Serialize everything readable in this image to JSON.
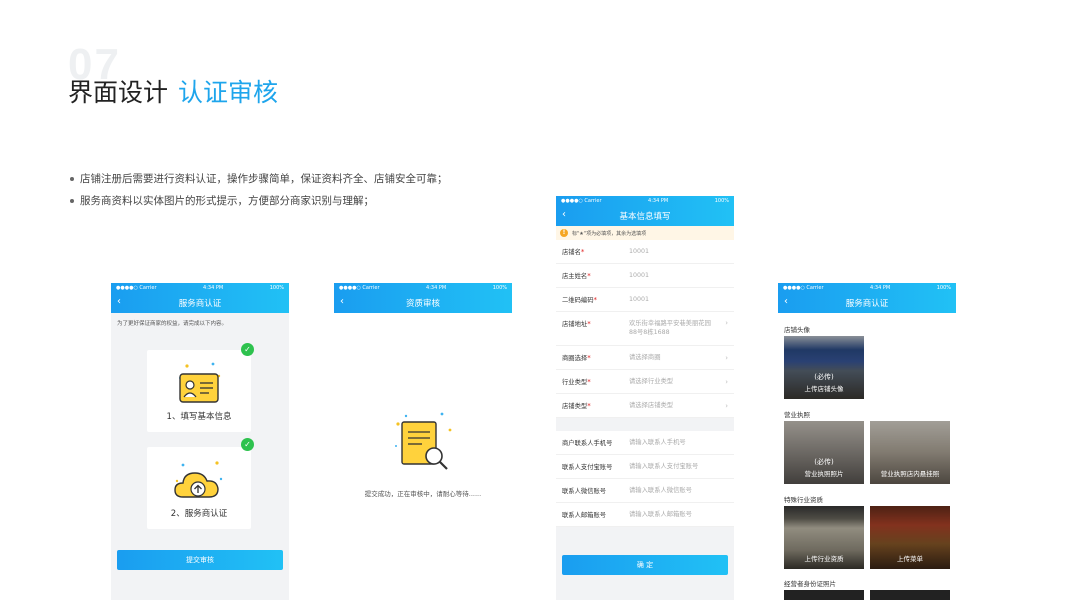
{
  "header": {
    "section_number": "07",
    "title_main": "界面设计",
    "title_accent": "认证审核"
  },
  "bullets": [
    "店铺注册后需要进行资料认证，操作步骤简单，保证资料齐全、店铺安全可靠；",
    "服务商资料以实体图片的形式提示，方便部分商家识别与理解；"
  ],
  "status_bar": {
    "carrier": "●●●●○ Carrier",
    "time": "4:34 PM",
    "battery": "100%"
  },
  "screen1": {
    "nav_title": "服务商认证",
    "hint": "为了更好保证商家的权益，请完成以下内容。",
    "steps": [
      {
        "label": "1、填写基本信息",
        "icon": "id-card-icon"
      },
      {
        "label": "2、服务商认证",
        "icon": "cloud-upload-icon"
      }
    ],
    "submit": "提交审核"
  },
  "screen2": {
    "nav_title": "资质审核",
    "message": "提交成功，正在审核中，请耐心等待......"
  },
  "screen3": {
    "nav_title": "基本信息填写",
    "notice": "标\"★\"项为必填项，其余为选填项",
    "fields": [
      {
        "label": "店铺名",
        "required": true,
        "value": "10001"
      },
      {
        "label": "店主姓名",
        "required": true,
        "value": "10001"
      },
      {
        "label": "二维码编码",
        "required": true,
        "value": "10001"
      },
      {
        "label": "店铺地址",
        "required": true,
        "value": "欢乐街幸福路平安巷美丽花园88号8栋1688",
        "arrow": true
      },
      {
        "label": "商圈选择",
        "required": true,
        "value": "请选择商圈",
        "arrow": true
      },
      {
        "label": "行业类型",
        "required": true,
        "value": "请选择行业类型",
        "arrow": true
      },
      {
        "label": "店铺类型",
        "required": true,
        "value": "请选择店铺类型",
        "arrow": true
      }
    ],
    "contacts": [
      {
        "label": "商户联系人手机号",
        "placeholder": "请输入联系人手机号"
      },
      {
        "label": "联系人支付宝账号",
        "placeholder": "请输入联系人支付宝账号"
      },
      {
        "label": "联系人微信账号",
        "placeholder": "请输入联系人微信账号"
      },
      {
        "label": "联系人邮箱账号",
        "placeholder": "请输入联系人邮箱账号"
      }
    ],
    "confirm": "确 定"
  },
  "screen4": {
    "nav_title": "服务商认证",
    "sections": {
      "shop_avatar": "店铺头像",
      "license": "营业执照",
      "industry": "特殊行业资质",
      "id_photo": "经营者身份证照片"
    },
    "photos": {
      "shop_must": "(必传)",
      "shop_cap": "上传店铺头像",
      "lic1_must": "(必传)",
      "lic1_cap": "营业执照照片",
      "lic2_cap": "营业执照店内悬挂照",
      "ind1_cap": "上传行业资质",
      "ind2_cap": "上传菜单"
    }
  }
}
